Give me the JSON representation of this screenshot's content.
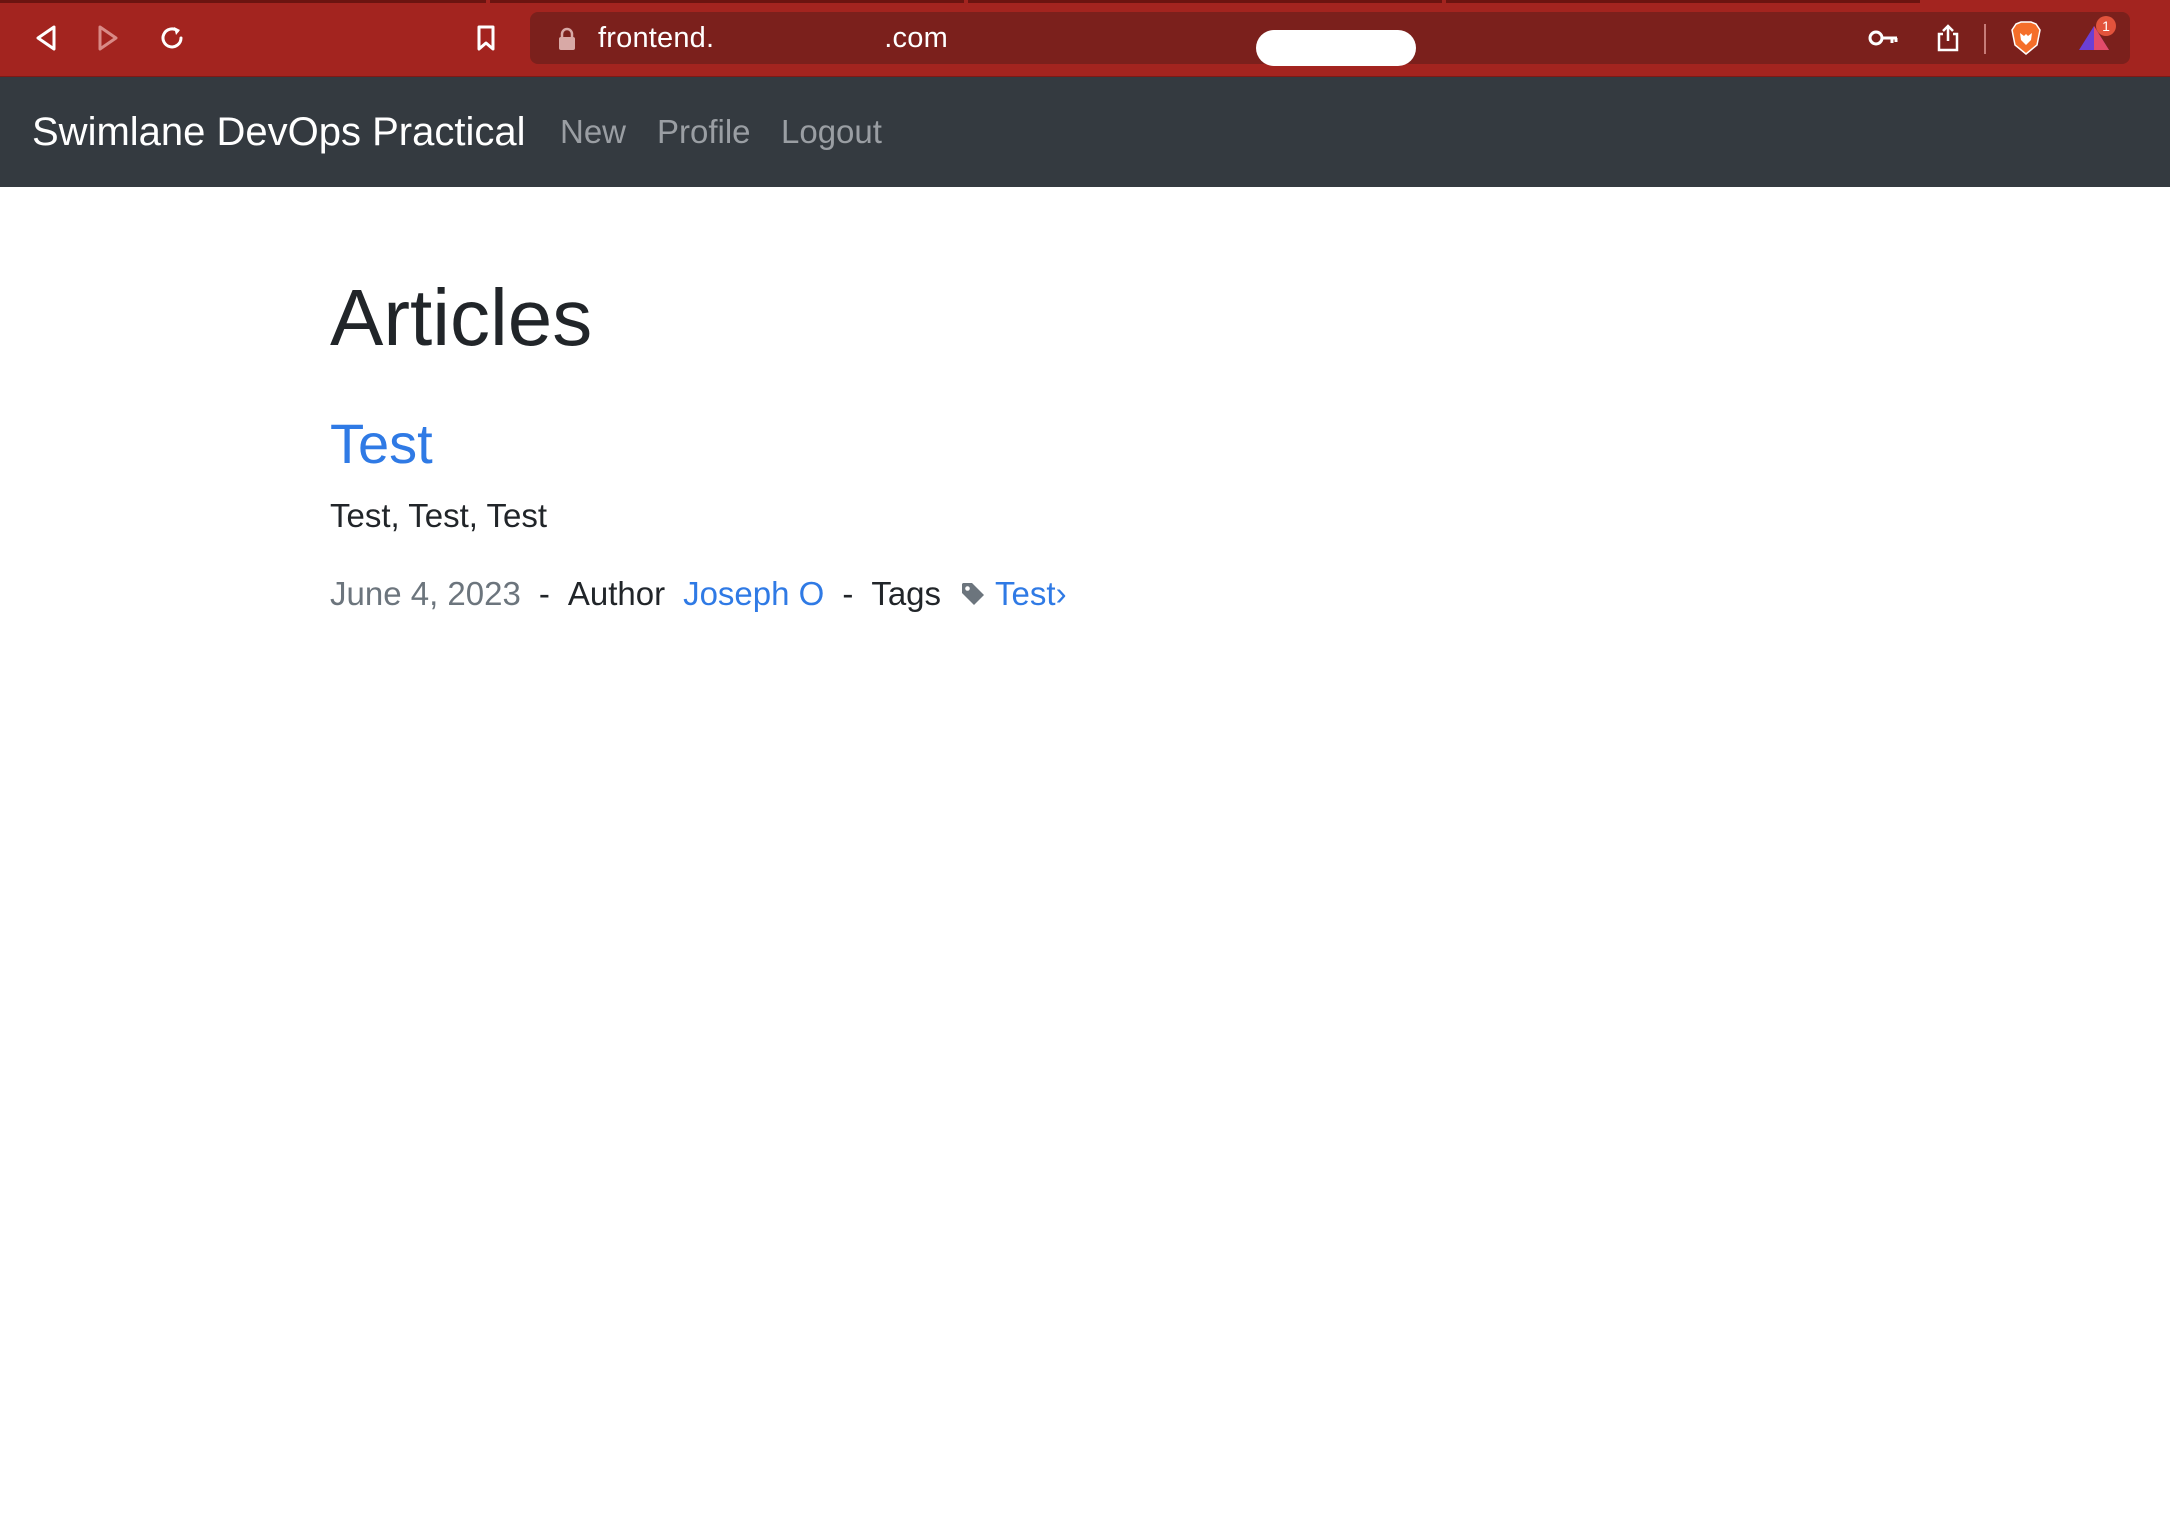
{
  "browser": {
    "url_prefix": "frontend.",
    "url_suffix": ".com",
    "shield_badge_count": "1",
    "icons": {
      "back": "back-arrow-icon",
      "forward": "forward-arrow-icon",
      "reload": "reload-icon",
      "bookmark": "bookmark-icon",
      "lock": "lock-icon",
      "key": "key-icon",
      "share": "share-icon",
      "brave": "brave-lion-icon",
      "rewards": "brave-rewards-icon"
    },
    "colors": {
      "chrome": "#a3241f",
      "address_bar": "#7b201c"
    }
  },
  "navbar": {
    "brand": "Swimlane DevOps Practical",
    "links": [
      "New",
      "Profile",
      "Logout"
    ],
    "colors": {
      "background": "#343a40",
      "link": "#9a9ea3"
    }
  },
  "main": {
    "title": "Articles",
    "articles": [
      {
        "title": "Test",
        "description": "Test, Test, Test",
        "date": "June 4, 2023",
        "separator": "-",
        "author_label": "Author",
        "author": "Joseph O",
        "tags_label": "Tags",
        "tags": [
          "Test›"
        ],
        "tag_icon": "tag-icon"
      }
    ],
    "colors": {
      "link": "#2f7ae5",
      "muted": "#6c757d",
      "text": "#212529"
    }
  }
}
